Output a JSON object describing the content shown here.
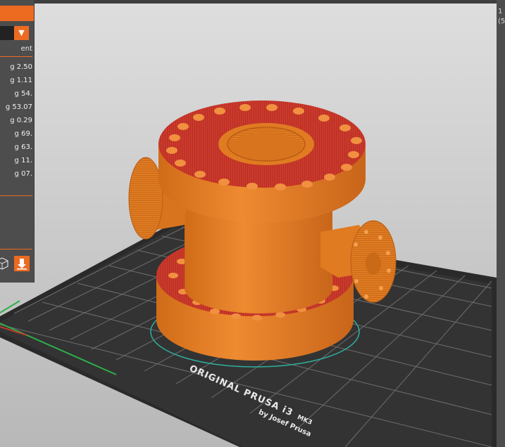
{
  "left_panel": {
    "column_header": "ent",
    "rows": [
      "2.50 g",
      "1.11 g",
      ".54 g",
      "53.07 g",
      "0.29 g",
      ".69 g",
      ".63 g",
      ".11 g",
      ".07 g"
    ],
    "export_button_icon": "export-icon",
    "view_toggle_icon": "cube-outline-icon"
  },
  "right_strip": {
    "line1": "1",
    "line2": "(5"
  },
  "bed": {
    "label_line1": "ORIGINAL PRUSA i3",
    "label_mk": "MK3",
    "label_line2": "by Josef Prusa"
  },
  "colors": {
    "accent": "#ed6b21",
    "panel": "#4d4d4d",
    "model_orange": "#e07b22",
    "model_red": "#cc3a2c",
    "bed": "#2b2b2b",
    "grid": "#6a6a6a"
  }
}
